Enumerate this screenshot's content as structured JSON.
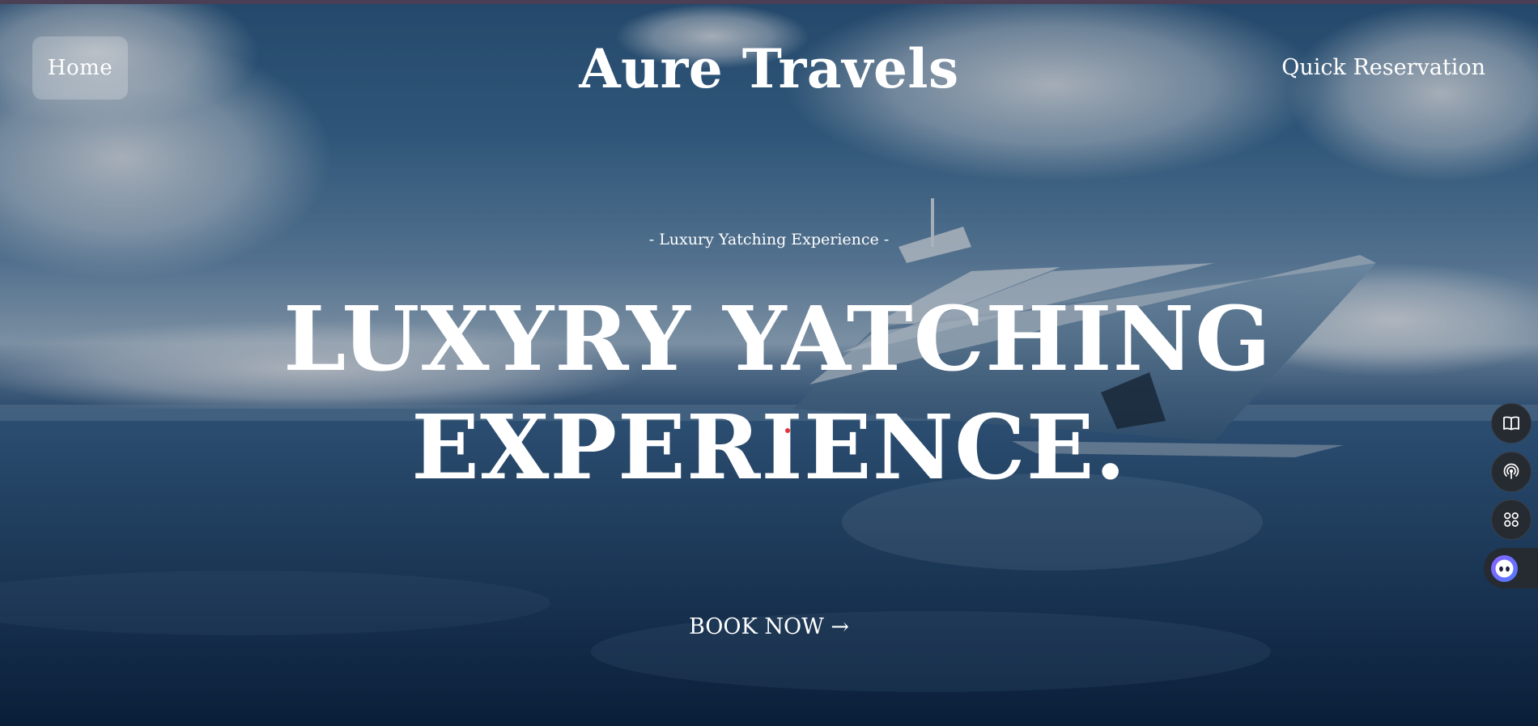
{
  "header": {
    "home_label": "Home",
    "brand": "Aure Travels",
    "quick_reservation_label": "Quick Reservation"
  },
  "hero": {
    "subtitle": "- Luxury Yatching Experience -",
    "headline_line1": "LUXYRY YATCHING",
    "headline_line2": "EXPERIENCE.",
    "cta_label": "BOOK NOW →"
  },
  "side_tools": [
    {
      "icon": "book-icon"
    },
    {
      "icon": "broadcast-icon"
    },
    {
      "icon": "apps-icon"
    },
    {
      "icon": "assistant-face-icon"
    }
  ],
  "colors": {
    "text": "#ffffff",
    "tool_bg": "#262a31",
    "assistant_accent": "#8a63ff"
  }
}
